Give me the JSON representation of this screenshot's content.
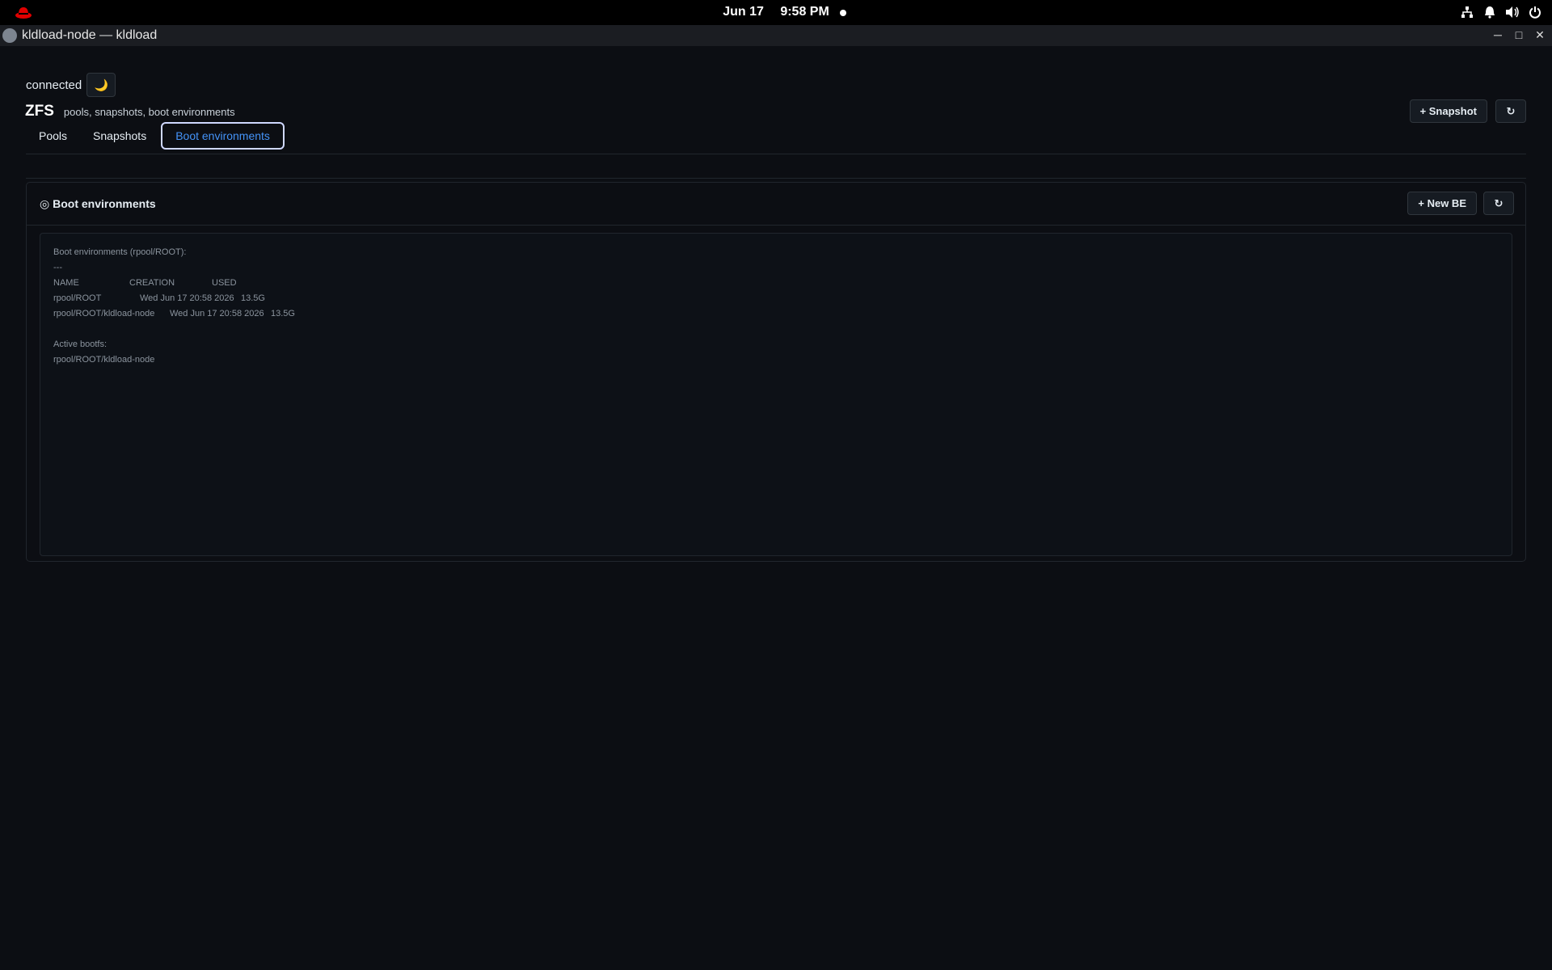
{
  "topbar": {
    "date": "Jun 17",
    "time": "9:58 PM"
  },
  "window": {
    "title": "kldload-node — kldload"
  },
  "status": {
    "text": "connected",
    "theme_icon": "moon-icon"
  },
  "page": {
    "title": "ZFS",
    "subtitle": "pools, snapshots, boot environments",
    "snapshot_button": "+ Snapshot",
    "refresh_icon": "↻"
  },
  "tabs": [
    {
      "label": "Pools"
    },
    {
      "label": "Snapshots"
    },
    {
      "label": "Boot environments"
    }
  ],
  "card": {
    "title": "◎ Boot environments",
    "new_be_button": "+ New BE",
    "refresh_icon": "↻"
  },
  "console": {
    "header": "Boot environments (rpool/ROOT):",
    "separator": "---",
    "columns": {
      "name": "NAME",
      "creation": "CREATION",
      "used": "USED"
    },
    "rows": [
      {
        "name": "rpool/ROOT",
        "creation": "Wed Jun 17 20:58 2026",
        "used": "13.5G"
      },
      {
        "name": "rpool/ROOT/kldload-node",
        "creation": "Wed Jun 17 20:58 2026",
        "used": "13.5G"
      }
    ],
    "active_label": "Active bootfs:",
    "active_value": "rpool/ROOT/kldload-node"
  },
  "colors": {
    "accent": "#4493f8",
    "background": "#0c0e13",
    "logo": "#e00000"
  }
}
